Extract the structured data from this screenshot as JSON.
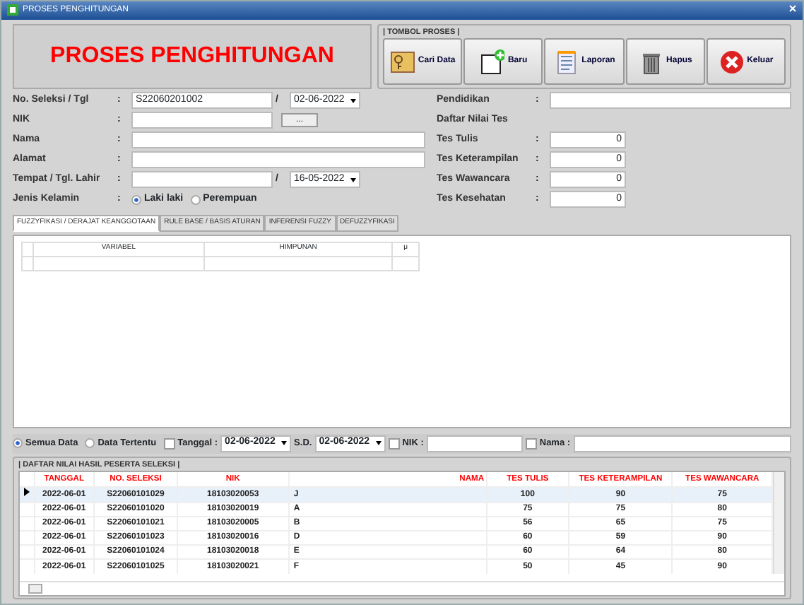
{
  "window": {
    "title": "PROSES PENGHITUNGAN"
  },
  "header": {
    "title": "PROSES PENGHITUNGAN"
  },
  "process_buttons": {
    "label": "| TOMBOL PROSES |",
    "buttons": [
      {
        "label": "Cari Data",
        "kind": "key"
      },
      {
        "label": "Baru",
        "kind": "new"
      },
      {
        "label": "Laporan",
        "kind": "report"
      },
      {
        "label": "Hapus",
        "kind": "trash"
      },
      {
        "label": "Keluar",
        "kind": "exit"
      }
    ]
  },
  "form_left": [
    {
      "label": "No. Seleksi / Tgl",
      "colon": ":",
      "kind": "text-date",
      "value": "S22060201002",
      "separator": "/",
      "date": "02-06-2022"
    },
    {
      "label": "NIK",
      "colon": ":",
      "kind": "text-button",
      "button": "..."
    },
    {
      "label": "Nama",
      "colon": ":",
      "kind": "text"
    },
    {
      "label": "Alamat",
      "colon": ":",
      "kind": "text"
    },
    {
      "label": "Tempat / Tgl. Lahir",
      "colon": ":",
      "kind": "text-date",
      "separator": "/",
      "date": "16-05-2022"
    },
    {
      "label": "Jenis Kelamin",
      "colon": ":",
      "kind": "radio",
      "options": [
        {
          "label": "Laki laki",
          "selected": true
        },
        {
          "label": "Perempuan",
          "selected": false
        }
      ]
    }
  ],
  "form_right": [
    {
      "label": "Pendidikan",
      "colon": ":",
      "kind": "text"
    },
    {
      "label": "Daftar Nilai Tes",
      "kind": "heading"
    },
    {
      "label": "Tes Tulis",
      "colon": ":",
      "kind": "number",
      "value": "0"
    },
    {
      "label": "Tes Keterampilan",
      "colon": ":",
      "kind": "number",
      "value": "0"
    },
    {
      "label": "Tes Wawancara",
      "colon": ":",
      "kind": "number",
      "value": "0"
    },
    {
      "label": "Tes Kesehatan",
      "colon": ":",
      "kind": "number",
      "value": "0"
    }
  ],
  "tabs": [
    {
      "label": "FUZZYFIKASI / DERAJAT KEANGGOTAAN",
      "selected": true
    },
    {
      "label": "RULE BASE / BASIS ATURAN",
      "selected": false
    },
    {
      "label": "INFERENSI FUZZY",
      "selected": false
    },
    {
      "label": "DEFUZZYFIKASI",
      "selected": false
    }
  ],
  "fuzzy_table": {
    "columns": [
      "VARIABEL",
      "HIMPUNAN",
      "μ"
    ]
  },
  "filter": {
    "radios": [
      {
        "label": "Semua Data",
        "selected": true
      },
      {
        "label": "Data Tertentu",
        "selected": false
      }
    ],
    "date": {
      "label": "Tanggal :",
      "checked": false,
      "from": "02-06-2022",
      "to_label": "S.D.",
      "to": "02-06-2022"
    },
    "nik": {
      "label": "NIK :",
      "checked": false
    },
    "name": {
      "label": "Nama :",
      "checked": false
    }
  },
  "results": {
    "title": "| DAFTAR NILAI HASIL PESERTA SELEKSI |",
    "columns": [
      "TANGGAL",
      "NO. SELEKSI",
      "NIK",
      "NAMA",
      "TES TULIS",
      "TES KETERAMPILAN",
      "TES WAWANCARA"
    ],
    "rows": [
      {
        "cells": [
          "2022-06-01",
          "S22060101029",
          "18103020053",
          "J",
          "100",
          "90",
          "75"
        ],
        "selected": true
      },
      {
        "cells": [
          "2022-06-01",
          "S22060101020",
          "18103020019",
          "A",
          "75",
          "75",
          "80"
        ],
        "selected": false
      },
      {
        "cells": [
          "2022-06-01",
          "S22060101021",
          "18103020005",
          "B",
          "56",
          "65",
          "75"
        ],
        "selected": false
      },
      {
        "cells": [
          "2022-06-01",
          "S22060101023",
          "18103020016",
          "D",
          "60",
          "59",
          "90"
        ],
        "selected": false
      },
      {
        "cells": [
          "2022-06-01",
          "S22060101024",
          "18103020018",
          "E",
          "60",
          "64",
          "80"
        ],
        "selected": false
      },
      {
        "cells": [
          "2022-06-01",
          "S22060101025",
          "18103020021",
          "F",
          "50",
          "45",
          "90"
        ],
        "selected": false
      }
    ]
  }
}
